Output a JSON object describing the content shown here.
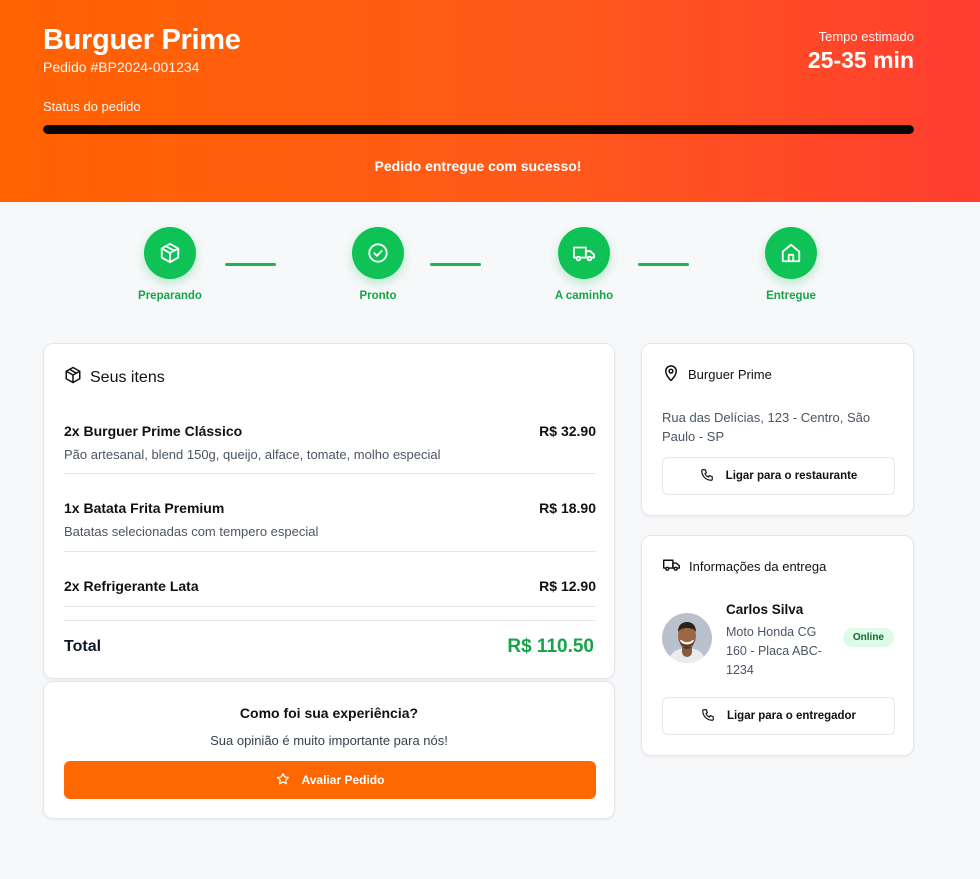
{
  "header": {
    "brand": "Burguer Prime",
    "order_id": "Pedido #BP2024-001234",
    "eta_label": "Tempo estimado",
    "eta_value": "25-35 min",
    "status_label": "Status do pedido",
    "progress_percent": 100,
    "progress_color": "#070707",
    "status_message": "Pedido entregue com sucesso!"
  },
  "steps": [
    {
      "label": "Preparando",
      "icon": "package-icon"
    },
    {
      "label": "Pronto",
      "icon": "check-circle-icon"
    },
    {
      "label": "A caminho",
      "icon": "truck-icon"
    },
    {
      "label": "Entregue",
      "icon": "home-icon"
    }
  ],
  "items_card": {
    "title": "Seus itens",
    "items": [
      {
        "name": "2x Burguer Prime Clássico",
        "price": "R$ 32.90",
        "description": "Pão artesanal, blend 150g, queijo, alface, tomate, molho especial"
      },
      {
        "name": "1x Batata Frita Premium",
        "price": "R$ 18.90",
        "description": "Batatas selecionadas com tempero especial"
      },
      {
        "name": "2x Refrigerante Lata",
        "price": "R$ 12.90",
        "description": ""
      }
    ],
    "total_label": "Total",
    "total_value": "R$ 110.50"
  },
  "rating": {
    "title": "Como foi sua experiência?",
    "subtitle": "Sua opinião é muito importante para nós!",
    "button_label": "Avaliar Pedido"
  },
  "restaurant": {
    "name": "Burguer Prime",
    "address": "Rua das Delícias, 123 - Centro, São Paulo - SP",
    "call_label": "Ligar para o restaurante"
  },
  "delivery": {
    "title": "Informações da entrega",
    "driver_name": "Carlos Silva",
    "vehicle": "Moto Honda CG 160 - Placa ABC-1234",
    "status_badge": "Online",
    "call_label": "Ligar para o entregador"
  },
  "colors": {
    "brand_orange": "#ff6200",
    "header_end": "#ff3d30",
    "success_green": "#0ec255",
    "price_green": "#16a34a",
    "button_orange": "#ff6800"
  }
}
